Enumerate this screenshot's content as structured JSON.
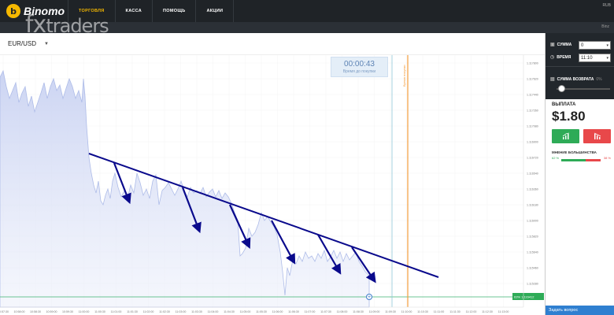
{
  "topbar": {
    "logo_glyph": "b",
    "brand": "Binomo",
    "nav": [
      {
        "label": "ТОРГОВЛЯ",
        "active": true
      },
      {
        "label": "КАССА",
        "active": false
      },
      {
        "label": "ПОМОЩЬ",
        "active": false
      },
      {
        "label": "АКЦИИ",
        "active": false
      }
    ],
    "right_text": "RUB"
  },
  "subbar": {
    "right_text": "Binz"
  },
  "watermark": {
    "fx": "fx",
    "traders": "traders"
  },
  "chart_header": {
    "pair": "EUR/USD"
  },
  "timer": {
    "value": "00:00:43",
    "label": "Время до покупки"
  },
  "chart_labels": {
    "purchase_line": "Время покупки",
    "current_tag": "63% 1.116412"
  },
  "price_axis": [
    "1.117800",
    "1.117620",
    "1.117440",
    "1.117260",
    "1.117080",
    "1.116900",
    "1.116720",
    "1.116540",
    "1.116360",
    "1.116180",
    "1.116000",
    "1.115820",
    "1.115640",
    "1.115460",
    "1.115280"
  ],
  "time_axis": [
    "10:57:30",
    "10:58:00",
    "10:58:30",
    "10:59:00",
    "10:59:30",
    "11:00:00",
    "11:00:30",
    "11:01:00",
    "11:01:30",
    "11:02:00",
    "11:02:30",
    "11:03:00",
    "11:03:30",
    "11:04:00",
    "11:04:30",
    "11:05:00",
    "11:05:30",
    "11:06:00",
    "11:06:30",
    "11:07:00",
    "11:07:30",
    "11:08:00",
    "11:08:30",
    "11:09:00",
    "11:09:30",
    "11:10:00",
    "11:10:30",
    "11:11:00",
    "11:11:30",
    "11:12:00",
    "11:12:30",
    "11:13:00"
  ],
  "panel": {
    "sum_label": "СУММА",
    "sum_value": "0",
    "time_label": "ВРЕМЯ",
    "time_value": "11:10",
    "return_label": "СУММА ВОЗВРАТА",
    "return_pct": "0%",
    "payout_label": "ВЫПЛАТА",
    "payout_value": "$1.80",
    "majority_label": "МНЕНИЕ БОЛЬШИНСТВА",
    "majority_up": "62 %",
    "majority_down": "38 %",
    "majority_up_fraction": 0.62,
    "help_button": "Задать вопрос"
  },
  "colors": {
    "topbar": "#1f2327",
    "accent": "#f5b800",
    "up": "#2eab57",
    "down": "#e8484a",
    "trend": "#0a0a8c",
    "area_fill": "#d5dcf5"
  }
}
